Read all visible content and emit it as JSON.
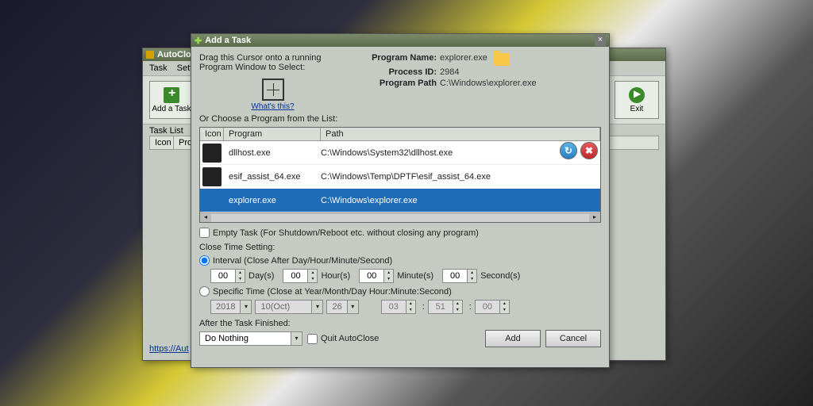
{
  "bgwin": {
    "title": "AutoClose",
    "menu": [
      "Task",
      "Setting"
    ],
    "toolbar": {
      "add": "Add a Task",
      "exit": "Exit"
    },
    "tasklist_label": "Task List",
    "headers": [
      "Icon",
      "Prog"
    ],
    "link": "https://Aut"
  },
  "dlg": {
    "title": "Add a Task",
    "drag_hint": "Drag this Cursor onto a running Program Window to Select:",
    "whats_this": "What's this?",
    "prog": {
      "name_label": "Program Name:",
      "name_value": "explorer.exe",
      "pid_label": "Process ID:",
      "pid_value": "2984",
      "path_label": "Program Path",
      "path_value": "C:\\Windows\\explorer.exe"
    },
    "list_label": "Or Choose a Program from the List:",
    "columns": {
      "icon": "Icon",
      "program": "Program",
      "path": "Path"
    },
    "rows": [
      {
        "program": "dllhost.exe",
        "path": "C:\\Windows\\System32\\dllhost.exe",
        "selected": false
      },
      {
        "program": "esif_assist_64.exe",
        "path": "C:\\Windows\\Temp\\DPTF\\esif_assist_64.exe",
        "selected": false
      },
      {
        "program": "explorer.exe",
        "path": "C:\\Windows\\explorer.exe",
        "selected": true
      }
    ],
    "empty_task": "Empty Task (For Shutdown/Reboot etc. without closing any program)",
    "close_time": "Close Time Setting:",
    "interval_label": "Interval (Close After Day/Hour/Minute/Second)",
    "interval": {
      "day": "00",
      "day_u": "Day(s)",
      "hour": "00",
      "hour_u": "Hour(s)",
      "min": "00",
      "min_u": "Minute(s)",
      "sec": "00",
      "sec_u": "Second(s)"
    },
    "specific_label": "Specific Time (Close at Year/Month/Day Hour:Minute:Second)",
    "specific": {
      "year": "2018",
      "month": "10(Oct)",
      "day": "26",
      "hour": "03",
      "min": "51",
      "sec": "00",
      "sep": ":"
    },
    "after_label": "After the Task Finished:",
    "after_value": "Do Nothing",
    "quit_label": "Quit AutoClose",
    "add_btn": "Add",
    "cancel_btn": "Cancel"
  }
}
